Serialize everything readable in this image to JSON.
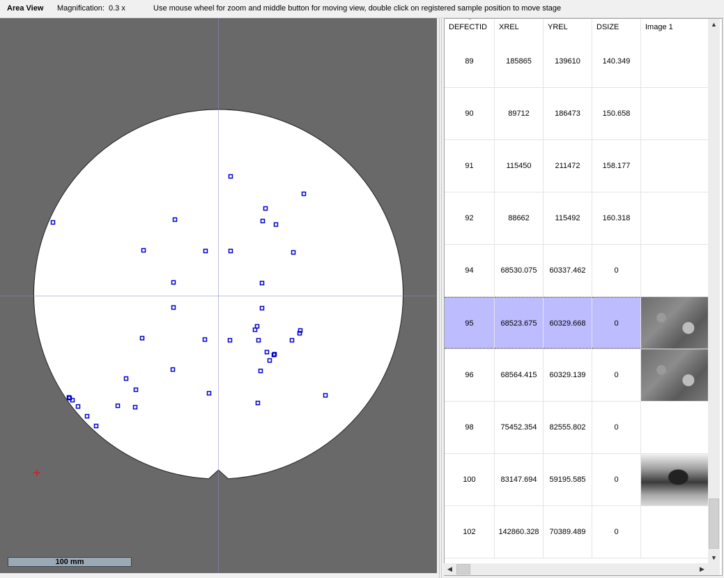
{
  "topbar": {
    "title": "Area View",
    "magnification_label": "Magnification:",
    "magnification_value": "0.3 x",
    "hint": "Use mouse wheel for zoom and middle button for moving view, double click on registered sample position to move stage"
  },
  "area_view": {
    "scale_label": "100 mm",
    "colors": {
      "background": "#696969",
      "wafer": "#ffffff",
      "defect_marker": "#0000cc",
      "stage_marker": "#ff0000"
    }
  },
  "table": {
    "columns": [
      "DEFECTID",
      "XREL",
      "YREL",
      "DSIZE",
      "Image 1"
    ],
    "rows": [
      {
        "id": "89",
        "xrel": "185865",
        "yrel": "139610",
        "dsize": "140.349",
        "image": ""
      },
      {
        "id": "90",
        "xrel": "89712",
        "yrel": "186473",
        "dsize": "150.658",
        "image": ""
      },
      {
        "id": "91",
        "xrel": "115450",
        "yrel": "211472",
        "dsize": "158.177",
        "image": ""
      },
      {
        "id": "92",
        "xrel": "88662",
        "yrel": "115492",
        "dsize": "160.318",
        "image": ""
      },
      {
        "id": "94",
        "xrel": "68530.075",
        "yrel": "60337.462",
        "dsize": "0",
        "image": ""
      },
      {
        "id": "95",
        "xrel": "68523.675",
        "yrel": "60329.668",
        "dsize": "0",
        "image": "sem-thumbnail-gray"
      },
      {
        "id": "96",
        "xrel": "68564.415",
        "yrel": "60329.139",
        "dsize": "0",
        "image": "sem-thumbnail-gray"
      },
      {
        "id": "98",
        "xrel": "75452.354",
        "yrel": "82555.802",
        "dsize": "0",
        "image": ""
      },
      {
        "id": "100",
        "xrel": "83147.694",
        "yrel": "59195.585",
        "dsize": "0",
        "image": "sem-thumbnail-dark"
      },
      {
        "id": "102",
        "xrel": "142860.328",
        "yrel": "70389.489",
        "dsize": "0",
        "image": ""
      }
    ],
    "selected_row_id": "95",
    "colors": {
      "selection": "#bcbcff"
    }
  }
}
